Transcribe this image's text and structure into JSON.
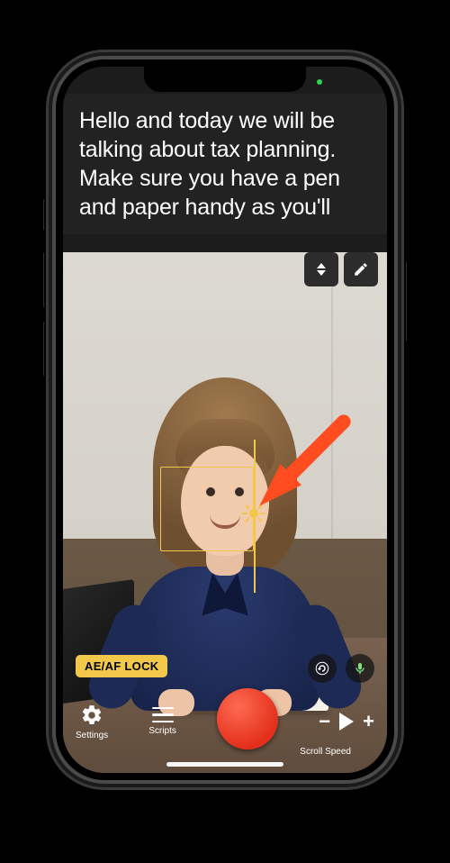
{
  "teleprompter": {
    "text": "Hello and today we will be talking about tax planning. Make sure you have a pen and paper handy as you'll"
  },
  "badges": {
    "aeaf_lock": "AE/AF LOCK"
  },
  "toolbar": {
    "settings_label": "Settings",
    "scripts_label": "Scripts",
    "scroll_speed_label": "Scroll Speed"
  },
  "icons": {
    "scroll_updown": "scroll-updown-icon",
    "edit": "pencil-icon",
    "settings": "gear-icon",
    "scripts": "menu-icon",
    "record": "record-icon",
    "speed_minus": "minus-icon",
    "speed_play": "play-icon",
    "speed_plus": "plus-icon",
    "switch_camera": "switch-camera-icon",
    "microphone": "microphone-icon",
    "focus_exposure": "sun-icon",
    "annotation_arrow": "arrow-down-left-icon"
  },
  "colors": {
    "accent_record": "#e4301b",
    "accent_focus": "#f2c84b",
    "annotation": "#ff4d1f"
  }
}
